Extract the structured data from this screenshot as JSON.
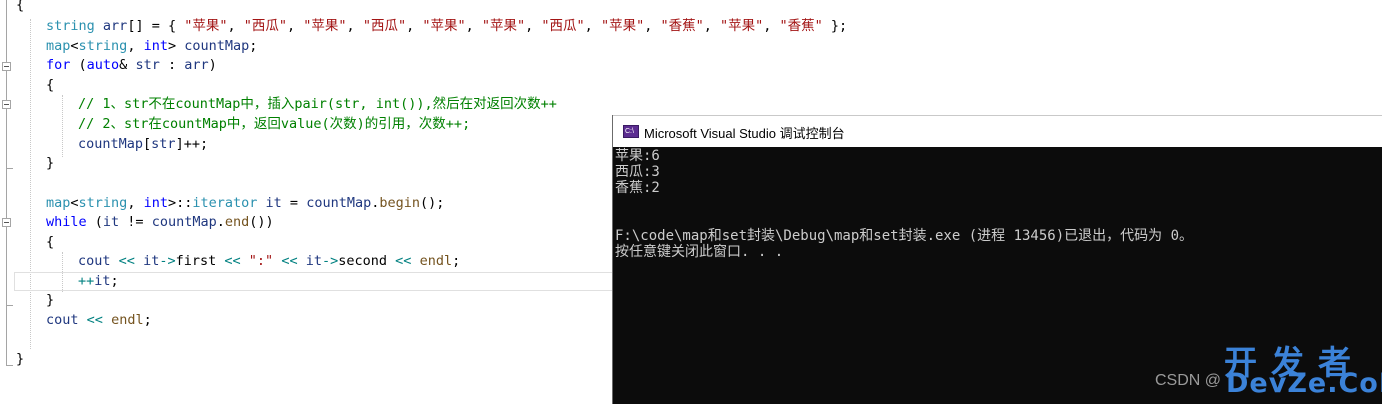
{
  "editor": {
    "lines": [
      {
        "segments": [
          {
            "c": "",
            "t": "{"
          }
        ]
      },
      {
        "segments": [
          {
            "c": "ty",
            "t": "string"
          },
          {
            "c": "",
            "t": " "
          },
          {
            "c": "var",
            "t": "arr"
          },
          {
            "c": "",
            "t": "[] = { "
          },
          {
            "c": "str",
            "t": "\"苹果\""
          },
          {
            "c": "",
            "t": ", "
          },
          {
            "c": "str",
            "t": "\"西瓜\""
          },
          {
            "c": "",
            "t": ", "
          },
          {
            "c": "str",
            "t": "\"苹果\""
          },
          {
            "c": "",
            "t": ", "
          },
          {
            "c": "str",
            "t": "\"西瓜\""
          },
          {
            "c": "",
            "t": ", "
          },
          {
            "c": "str",
            "t": "\"苹果\""
          },
          {
            "c": "",
            "t": ", "
          },
          {
            "c": "str",
            "t": "\"苹果\""
          },
          {
            "c": "",
            "t": ", "
          },
          {
            "c": "str",
            "t": "\"西瓜\""
          },
          {
            "c": "",
            "t": ", "
          },
          {
            "c": "str",
            "t": "\"苹果\""
          },
          {
            "c": "",
            "t": ", "
          },
          {
            "c": "str",
            "t": "\"香蕉\""
          },
          {
            "c": "",
            "t": ", "
          },
          {
            "c": "str",
            "t": "\"苹果\""
          },
          {
            "c": "",
            "t": ", "
          },
          {
            "c": "str",
            "t": "\"香蕉\""
          },
          {
            "c": "",
            "t": " };"
          }
        ]
      },
      {
        "segments": [
          {
            "c": "ty",
            "t": "map"
          },
          {
            "c": "",
            "t": "<"
          },
          {
            "c": "ty",
            "t": "string"
          },
          {
            "c": "",
            "t": ", "
          },
          {
            "c": "kw",
            "t": "int"
          },
          {
            "c": "",
            "t": "> "
          },
          {
            "c": "var",
            "t": "countMap"
          },
          {
            "c": "",
            "t": ";"
          }
        ]
      },
      {
        "segments": [
          {
            "c": "kw",
            "t": "for"
          },
          {
            "c": "",
            "t": " ("
          },
          {
            "c": "kw",
            "t": "auto"
          },
          {
            "c": "",
            "t": "& "
          },
          {
            "c": "var",
            "t": "str"
          },
          {
            "c": "",
            "t": " : "
          },
          {
            "c": "var",
            "t": "arr"
          },
          {
            "c": "",
            "t": ")"
          }
        ]
      },
      {
        "segments": [
          {
            "c": "",
            "t": "{"
          }
        ]
      },
      {
        "segments": [
          {
            "c": "cm",
            "t": "// 1、str不在countMap中，插入pair(str, int()),然后在对返回次数++"
          }
        ]
      },
      {
        "segments": [
          {
            "c": "cm",
            "t": "// 2、str在countMap中，返回value(次数)的引用，次数++;"
          }
        ]
      },
      {
        "segments": [
          {
            "c": "var",
            "t": "countMap"
          },
          {
            "c": "",
            "t": "["
          },
          {
            "c": "var",
            "t": "str"
          },
          {
            "c": "",
            "t": "]++;"
          }
        ]
      },
      {
        "segments": [
          {
            "c": "",
            "t": "}"
          }
        ]
      },
      {
        "segments": [
          {
            "c": "",
            "t": ""
          }
        ]
      },
      {
        "segments": [
          {
            "c": "ty",
            "t": "map"
          },
          {
            "c": "",
            "t": "<"
          },
          {
            "c": "ty",
            "t": "string"
          },
          {
            "c": "",
            "t": ", "
          },
          {
            "c": "kw",
            "t": "int"
          },
          {
            "c": "",
            "t": ">::"
          },
          {
            "c": "ty",
            "t": "iterator"
          },
          {
            "c": "",
            "t": " "
          },
          {
            "c": "var",
            "t": "it"
          },
          {
            "c": "",
            "t": " = "
          },
          {
            "c": "var",
            "t": "countMap"
          },
          {
            "c": "",
            "t": "."
          },
          {
            "c": "fn",
            "t": "begin"
          },
          {
            "c": "",
            "t": "();"
          }
        ]
      },
      {
        "segments": [
          {
            "c": "kw",
            "t": "while"
          },
          {
            "c": "",
            "t": " ("
          },
          {
            "c": "var",
            "t": "it"
          },
          {
            "c": "",
            "t": " != "
          },
          {
            "c": "var",
            "t": "countMap"
          },
          {
            "c": "",
            "t": "."
          },
          {
            "c": "fn",
            "t": "end"
          },
          {
            "c": "",
            "t": "())"
          }
        ]
      },
      {
        "segments": [
          {
            "c": "",
            "t": "{"
          }
        ]
      },
      {
        "segments": [
          {
            "c": "var",
            "t": "cout"
          },
          {
            "c": "",
            "t": " "
          },
          {
            "c": "op",
            "t": "<<"
          },
          {
            "c": "",
            "t": " "
          },
          {
            "c": "var",
            "t": "it"
          },
          {
            "c": "op",
            "t": "->"
          },
          {
            "c": "",
            "t": "first "
          },
          {
            "c": "op",
            "t": "<<"
          },
          {
            "c": "",
            "t": " "
          },
          {
            "c": "str",
            "t": "\":\""
          },
          {
            "c": "",
            "t": " "
          },
          {
            "c": "op",
            "t": "<<"
          },
          {
            "c": "",
            "t": " "
          },
          {
            "c": "var",
            "t": "it"
          },
          {
            "c": "op",
            "t": "->"
          },
          {
            "c": "",
            "t": "second "
          },
          {
            "c": "op",
            "t": "<<"
          },
          {
            "c": "",
            "t": " "
          },
          {
            "c": "fn",
            "t": "endl"
          },
          {
            "c": "",
            "t": ";"
          }
        ]
      },
      {
        "segments": [
          {
            "c": "op",
            "t": "++"
          },
          {
            "c": "var",
            "t": "it"
          },
          {
            "c": "",
            "t": ";"
          }
        ]
      },
      {
        "segments": [
          {
            "c": "",
            "t": "}"
          }
        ]
      },
      {
        "segments": [
          {
            "c": "var",
            "t": "cout"
          },
          {
            "c": "",
            "t": " "
          },
          {
            "c": "op",
            "t": "<<"
          },
          {
            "c": "",
            "t": " "
          },
          {
            "c": "fn",
            "t": "endl"
          },
          {
            "c": "",
            "t": ";"
          }
        ]
      },
      {
        "segments": [
          {
            "c": "",
            "t": ""
          }
        ]
      },
      {
        "segments": [
          {
            "c": "",
            "t": "}"
          }
        ]
      }
    ]
  },
  "console": {
    "title": "Microsoft Visual Studio 调试控制台",
    "icon": "console-app-icon",
    "icon_label": "C:\\",
    "output": [
      "苹果:6",
      "西瓜:3",
      "香蕉:2",
      "",
      "",
      "F:\\code\\map和set封装\\Debug\\map和set封装.exe (进程 13456)已退出，代码为 0。",
      "按任意键关闭此窗口. . ."
    ]
  },
  "watermark": {
    "text": "CSDN @",
    "logo_cn": "开发者",
    "logo_en": "DevZe.CoM"
  },
  "colors": {
    "keyword": "#0000ff",
    "type": "#2b91af",
    "string": "#a31515",
    "comment": "#008000",
    "console_bg": "#0c0c0c",
    "console_fg": "#cccccc",
    "logo": "#3b82d8"
  }
}
